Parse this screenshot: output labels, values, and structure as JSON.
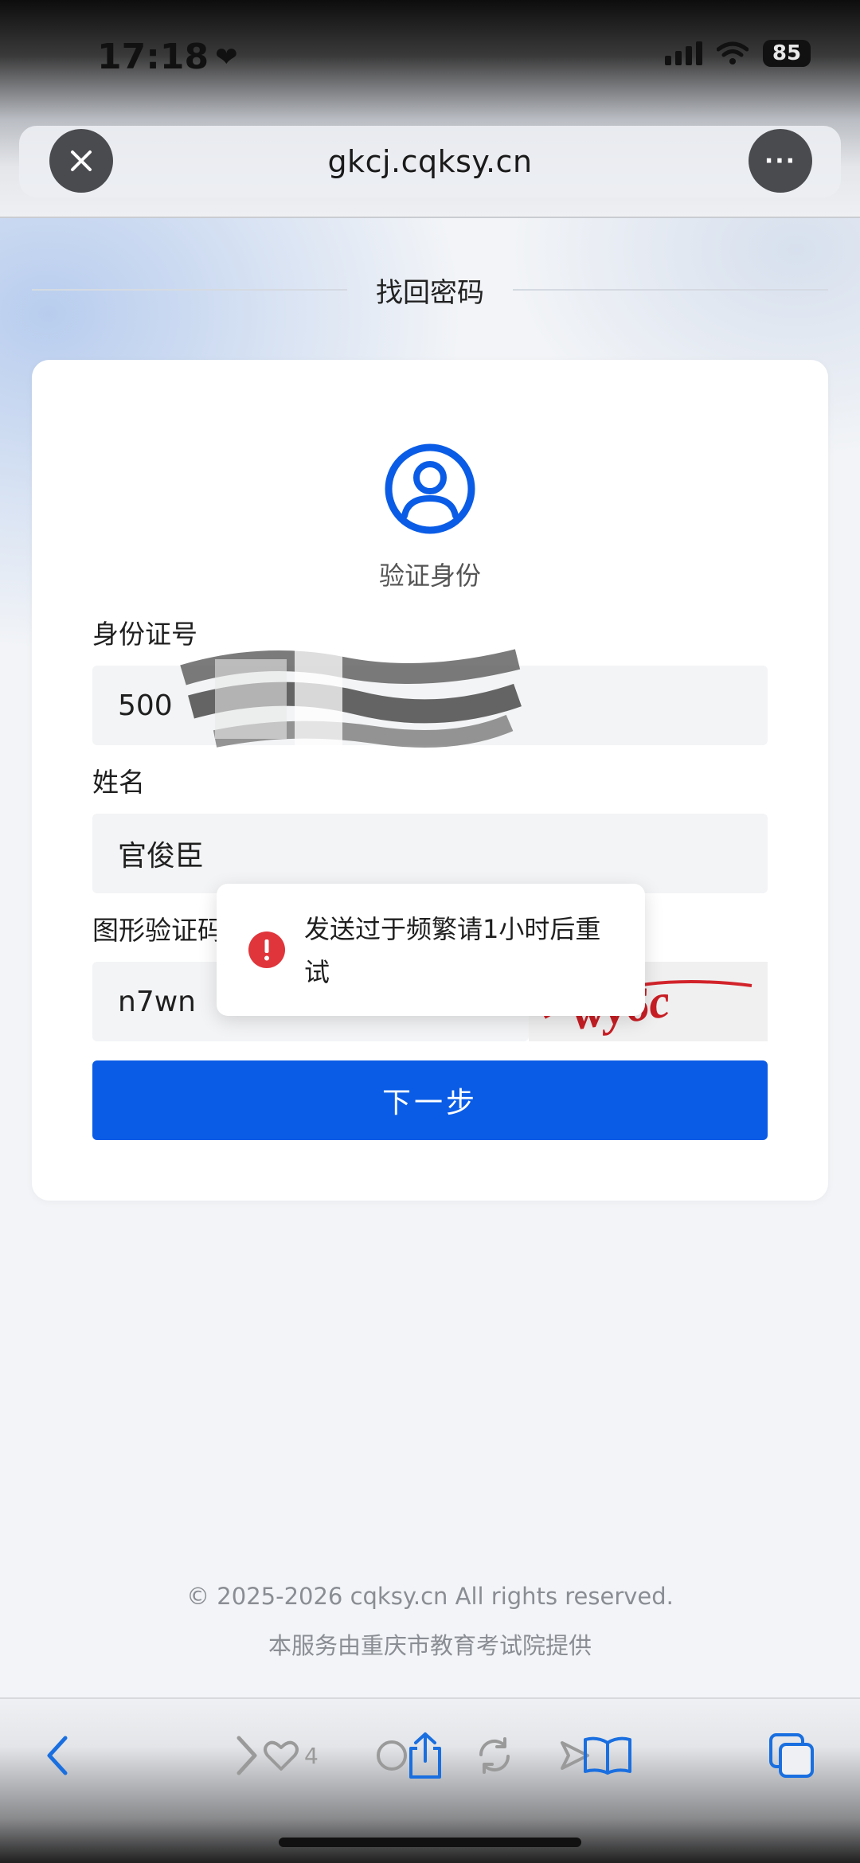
{
  "status_bar": {
    "time": "17:18",
    "battery": "85"
  },
  "browser": {
    "url": "gkcj.cqksy.cn",
    "close_label": "✕",
    "more_label": "···"
  },
  "page": {
    "title": "找回密码"
  },
  "card": {
    "subtitle": "验证身份",
    "id_label": "身份证号",
    "id_value": "500",
    "name_label": "姓名",
    "name_value": "官俊臣",
    "captcha_label": "图形验证码",
    "captcha_value": "n7wn",
    "captcha_image_text": "wy6c",
    "next_button": "下一步"
  },
  "toast": {
    "message": "发送过于频繁请1小时后重试"
  },
  "footer": {
    "copyright": "© 2025-2026 cqksy.cn All rights reserved.",
    "provider": "本服务由重庆市教育考试院提供"
  },
  "toolbar": {
    "like_count": "4"
  },
  "colors": {
    "primary": "#0a5ce6",
    "error": "#e0353b",
    "page_bg": "#f2f4f7"
  }
}
